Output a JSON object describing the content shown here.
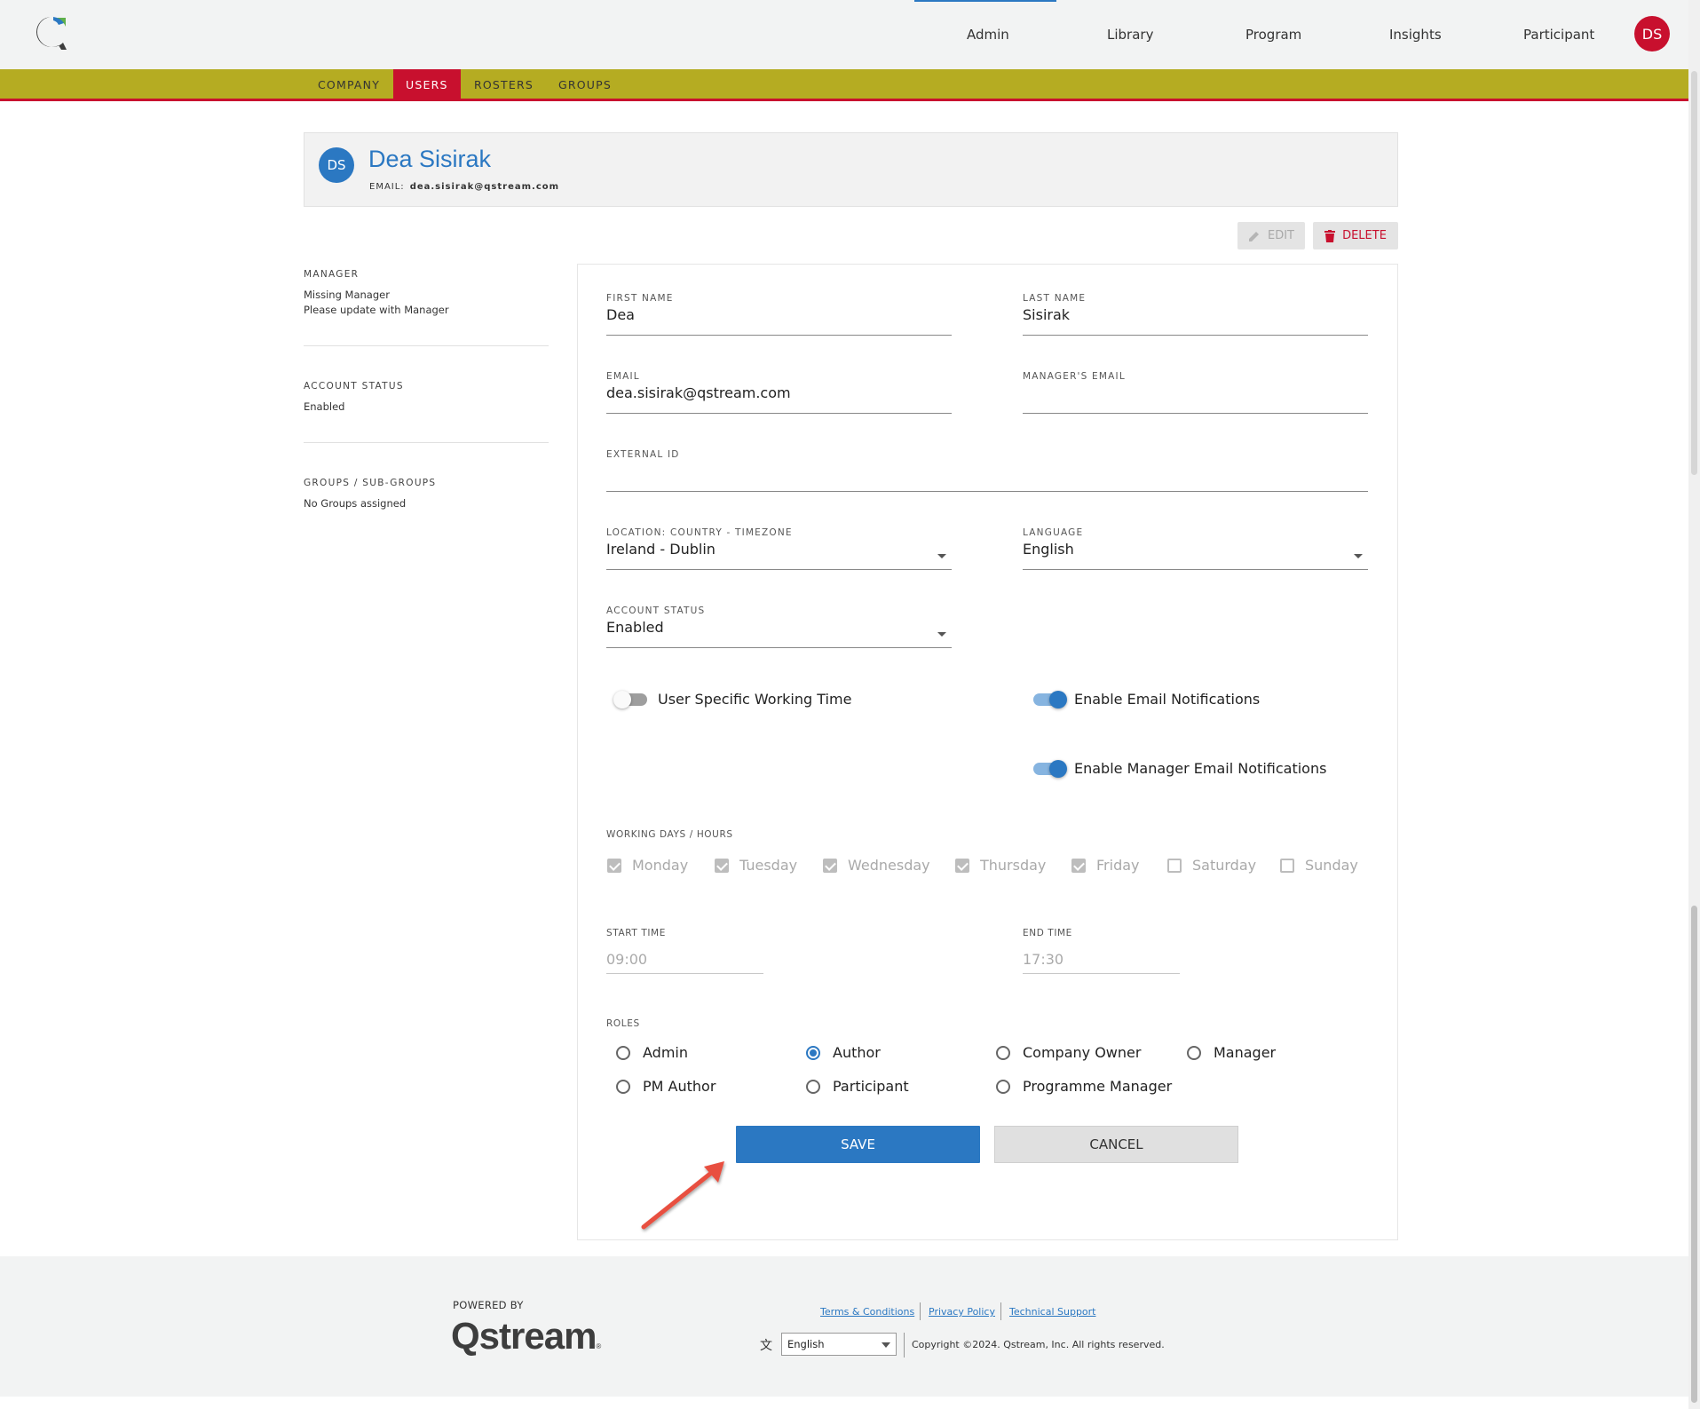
{
  "nav": {
    "items": [
      "Admin",
      "Library",
      "Program",
      "Insights",
      "Participant"
    ],
    "avatar_initials": "DS"
  },
  "subnav": {
    "tabs": [
      "COMPANY",
      "USERS",
      "ROSTERS",
      "GROUPS"
    ],
    "active": "USERS"
  },
  "user_card": {
    "initials": "DS",
    "name": "Dea Sisirak",
    "email_label": "EMAIL:",
    "email": "dea.sisirak@qstream.com"
  },
  "actions": {
    "edit": "EDIT",
    "delete": "DELETE"
  },
  "sidebar": {
    "manager_label": "MANAGER",
    "manager_line1": "Missing Manager",
    "manager_line2": "Please update with Manager",
    "status_label": "ACCOUNT STATUS",
    "status_value": "Enabled",
    "groups_label": "GROUPS / SUB-GROUPS",
    "groups_value": "No Groups assigned"
  },
  "form": {
    "first_name_label": "FIRST NAME",
    "first_name": "Dea",
    "last_name_label": "LAST NAME",
    "last_name": "Sisirak",
    "email_label": "EMAIL",
    "email": "dea.sisirak@qstream.com",
    "manager_email_label": "MANAGER'S EMAIL",
    "manager_email": "",
    "external_id_label": "EXTERNAL ID",
    "external_id": "",
    "location_label": "LOCATION: COUNTRY - TIMEZONE",
    "location": "Ireland - Dublin",
    "language_label": "LANGUAGE",
    "language": "English",
    "account_status_label": "ACCOUNT STATUS",
    "account_status": "Enabled",
    "toggles": {
      "working_time": {
        "label": "User Specific Working Time",
        "on": false
      },
      "email_notifications": {
        "label": "Enable Email Notifications",
        "on": true
      },
      "manager_email_notifications": {
        "label": "Enable Manager Email Notifications",
        "on": true
      }
    },
    "working_days_label": "WORKING DAYS / HOURS",
    "days": [
      {
        "name": "Monday",
        "checked": true
      },
      {
        "name": "Tuesday",
        "checked": true
      },
      {
        "name": "Wednesday",
        "checked": true
      },
      {
        "name": "Thursday",
        "checked": true
      },
      {
        "name": "Friday",
        "checked": true
      },
      {
        "name": "Saturday",
        "checked": false
      },
      {
        "name": "Sunday",
        "checked": false
      }
    ],
    "start_time_label": "START TIME",
    "start_time": "09:00",
    "end_time_label": "END TIME",
    "end_time": "17:30",
    "roles_label": "ROLES",
    "roles": [
      {
        "name": "Admin",
        "selected": false
      },
      {
        "name": "Author",
        "selected": true
      },
      {
        "name": "Company Owner",
        "selected": false
      },
      {
        "name": "Manager",
        "selected": false
      },
      {
        "name": "PM Author",
        "selected": false
      },
      {
        "name": "Participant",
        "selected": false
      },
      {
        "name": "Programme Manager",
        "selected": false
      }
    ],
    "save": "SAVE",
    "cancel": "CANCEL"
  },
  "footer": {
    "powered_by": "POWERED BY",
    "brand": "Qstream",
    "links": [
      "Terms & Conditions",
      "Privacy Policy",
      "Technical Support"
    ],
    "language": "English",
    "copyright": "Copyright ©2024. Qstream, Inc. All rights reserved."
  },
  "colors": {
    "primary": "#2b78c2",
    "brand_red": "#c8102e",
    "subnav_olive": "#b5ac22",
    "annotation_arrow": "#e8503f"
  }
}
